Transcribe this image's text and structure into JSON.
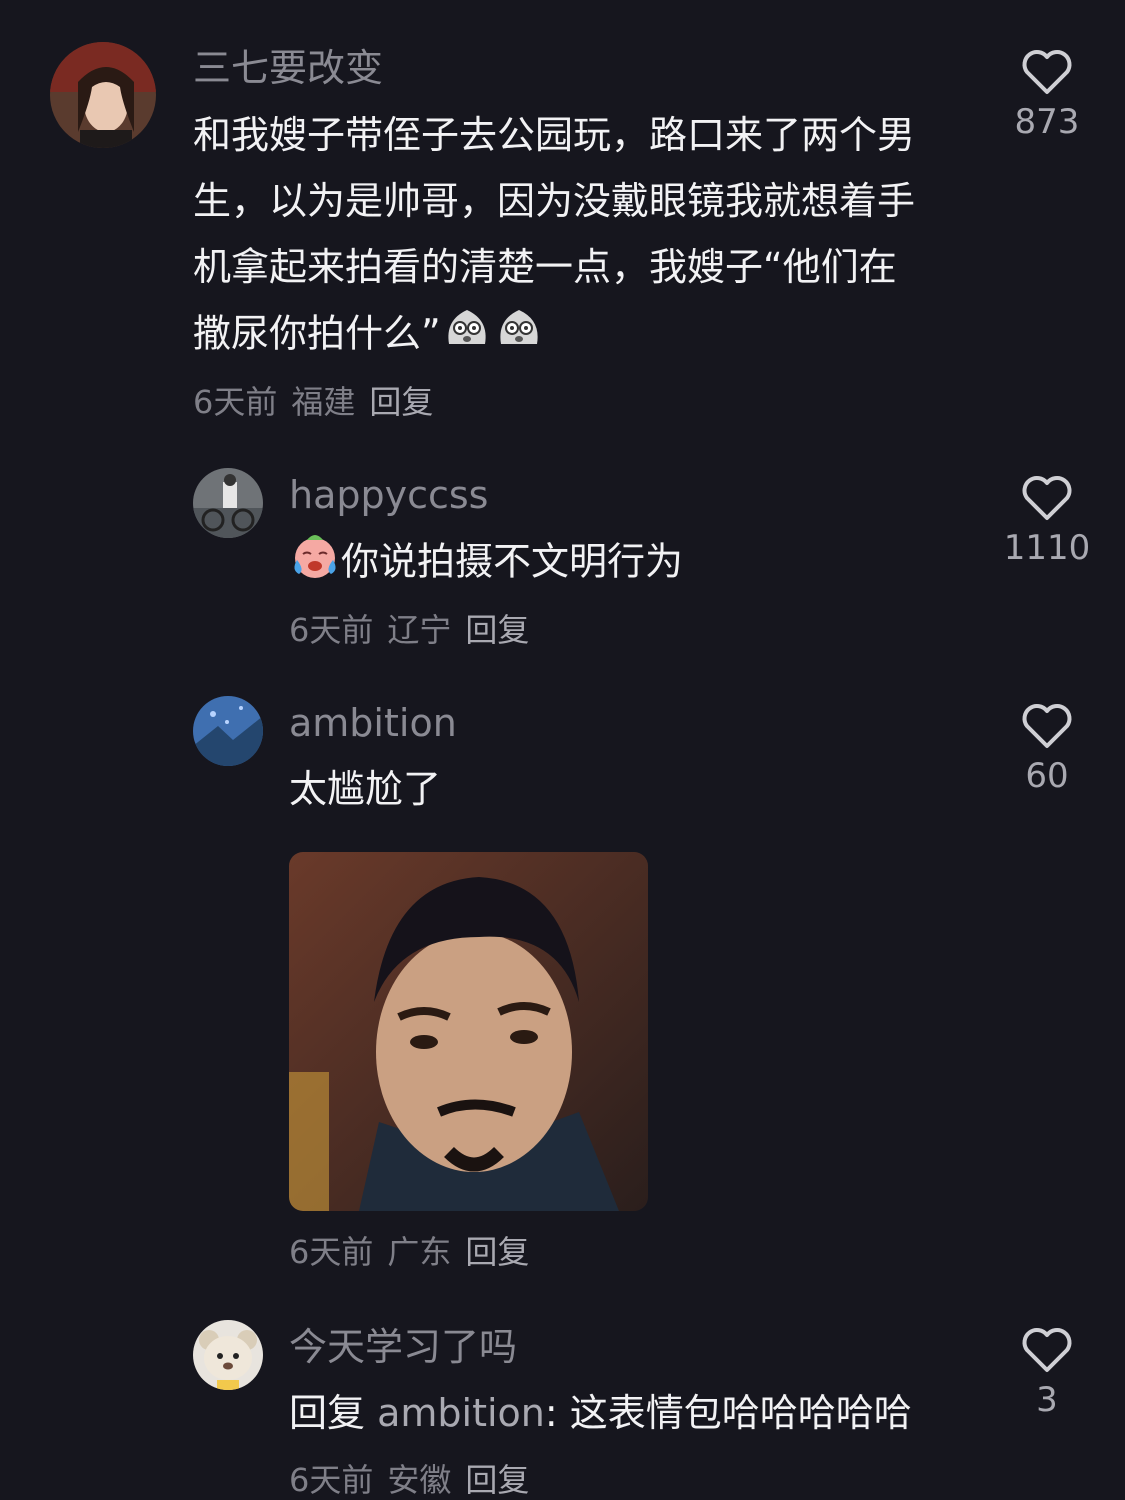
{
  "comments": [
    {
      "username": "三七要改变",
      "text": "和我嫂子带侄子去公园玩，路口来了两个男生，以为是帅哥，因为没戴眼镜我就想着手机拿起来拍看的清楚一点，我嫂子“他们在撒尿你拍什么”",
      "time": "6天前",
      "location": "福建",
      "reply_label": "回复",
      "likes": "873"
    },
    {
      "username": "happyccss",
      "text": "你说拍摄不文明行为",
      "time": "6天前",
      "location": "辽宁",
      "reply_label": "回复",
      "likes": "1110"
    },
    {
      "username": "ambition",
      "text": "太尴尬了",
      "time": "6天前",
      "location": "广东",
      "reply_label": "回复",
      "likes": "60"
    },
    {
      "username": "今天学习了吗",
      "reply_prefix": "回复",
      "reply_to": "ambition",
      "text": ": 这表情包哈哈哈哈哈",
      "time": "6天前",
      "location": "安徽",
      "reply_label": "回复",
      "likes": "3"
    }
  ],
  "icons": {
    "like": "heart-outline-icon",
    "emoji_cry": "crying-face-emoji",
    "emoji_shock": "shocked-face-emoji"
  },
  "colors": {
    "background": "#16161e",
    "text": "#f2f2f4",
    "secondary": "#8a8a93"
  }
}
